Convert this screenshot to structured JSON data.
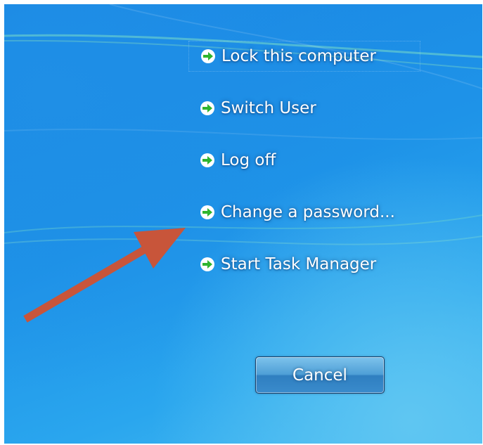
{
  "security_options": {
    "items": [
      {
        "label": "Lock this computer",
        "icon": "green-arrow-icon"
      },
      {
        "label": "Switch User",
        "icon": "green-arrow-icon"
      },
      {
        "label": "Log off",
        "icon": "green-arrow-icon"
      },
      {
        "label": "Change a password...",
        "icon": "green-arrow-icon"
      },
      {
        "label": "Start Task Manager",
        "icon": "green-arrow-icon"
      }
    ],
    "cancel_label": "Cancel"
  },
  "colors": {
    "background": "#1e93e8",
    "arrow_green": "#2fb52f",
    "annotation_arrow": "#c8553a",
    "text": "#ffffff"
  }
}
